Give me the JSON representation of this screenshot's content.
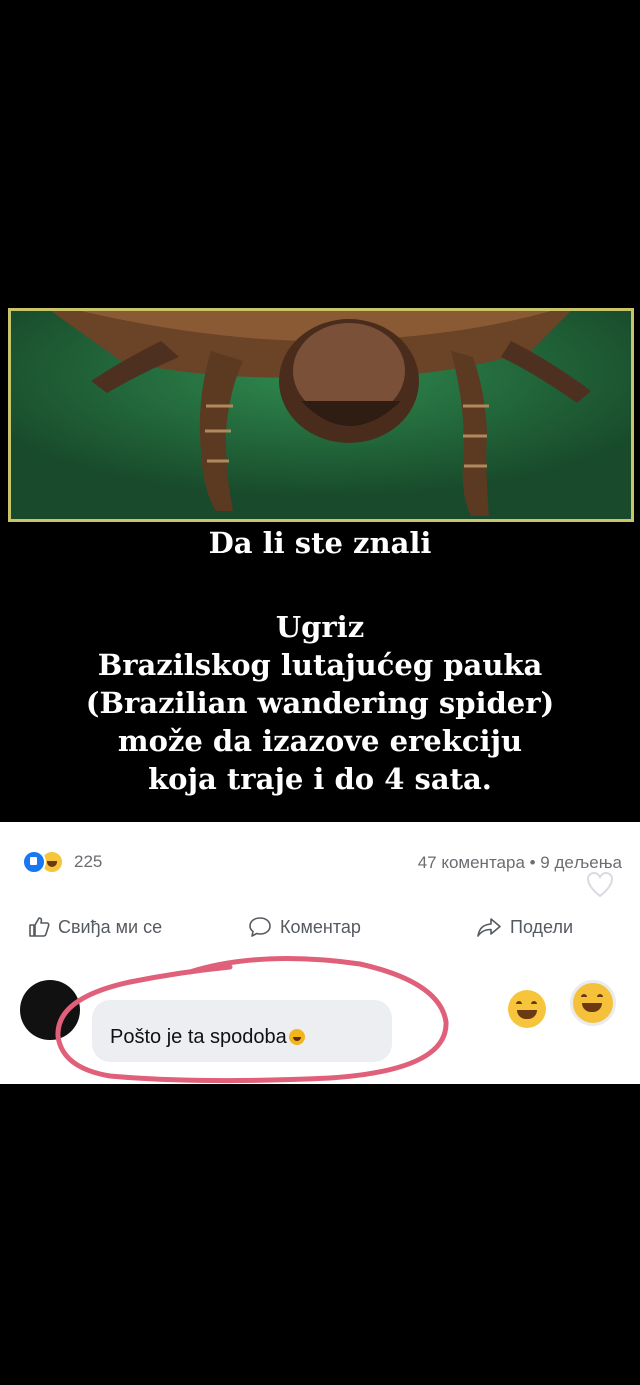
{
  "post": {
    "caption_title": "Da li ste znali",
    "caption_lines": [
      "Ugriz",
      "Brazilskog lutajućeg pauka",
      "(Brazilian wandering spider)",
      "može da izazove erekciju",
      "koja traje i do 4 sata."
    ]
  },
  "reactions": {
    "icons": [
      "like-icon",
      "haha-icon"
    ],
    "count": "225",
    "stats": "47 коментара • 9 дељења"
  },
  "actions": {
    "like": "Свиђа ми се",
    "comment": "Коментар",
    "share": "Подели"
  },
  "comment": {
    "text": "Pošto je ta spodoba",
    "highlight_color": "#e0607a"
  },
  "colors": {
    "background": "#000000",
    "border": "#c8c46a",
    "fb_blue": "#1877f2"
  }
}
